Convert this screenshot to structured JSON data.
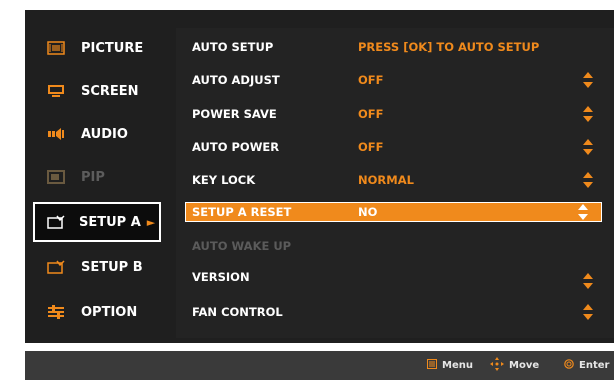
{
  "sidebar": {
    "items": [
      {
        "label": "PICTURE",
        "icon": "picture-icon",
        "state": "normal"
      },
      {
        "label": "SCREEN",
        "icon": "screen-icon",
        "state": "normal"
      },
      {
        "label": "AUDIO",
        "icon": "audio-icon",
        "state": "normal"
      },
      {
        "label": "PIP",
        "icon": "pip-icon",
        "state": "disabled"
      },
      {
        "label": "SETUP A",
        "icon": "setup-a-icon",
        "state": "active",
        "arrow": "►"
      },
      {
        "label": "SETUP B",
        "icon": "setup-b-icon",
        "state": "normal"
      },
      {
        "label": "OPTION",
        "icon": "option-icon",
        "state": "normal"
      }
    ]
  },
  "panel": {
    "rows": [
      {
        "name": "AUTO SETUP",
        "value": "PRESS [OK] TO AUTO SETUP",
        "state": "normal",
        "arrows": false
      },
      {
        "name": "AUTO ADJUST",
        "value": "OFF",
        "state": "normal",
        "arrows": true
      },
      {
        "name": "POWER SAVE",
        "value": "OFF",
        "state": "normal",
        "arrows": true
      },
      {
        "name": "AUTO POWER",
        "value": "OFF",
        "state": "normal",
        "arrows": true
      },
      {
        "name": "KEY LOCK",
        "value": "NORMAL",
        "state": "normal",
        "arrows": true
      },
      {
        "name": "SETUP A RESET",
        "value": "NO",
        "state": "selected",
        "arrows": true
      },
      {
        "name": "AUTO WAKE UP",
        "value": "",
        "state": "disabled",
        "arrows": false
      },
      {
        "name": "VERSION",
        "value": "",
        "state": "normal",
        "arrows": true
      },
      {
        "name": "FAN CONTROL",
        "value": "",
        "state": "normal",
        "arrows": true
      }
    ]
  },
  "footer": {
    "menu_label": "Menu",
    "move_label": "Move",
    "enter_label": "Enter"
  },
  "colors": {
    "accent": "#f08a1c",
    "background": "#1f1f1f",
    "panel": "#232323",
    "footer": "#3a3a3a"
  }
}
